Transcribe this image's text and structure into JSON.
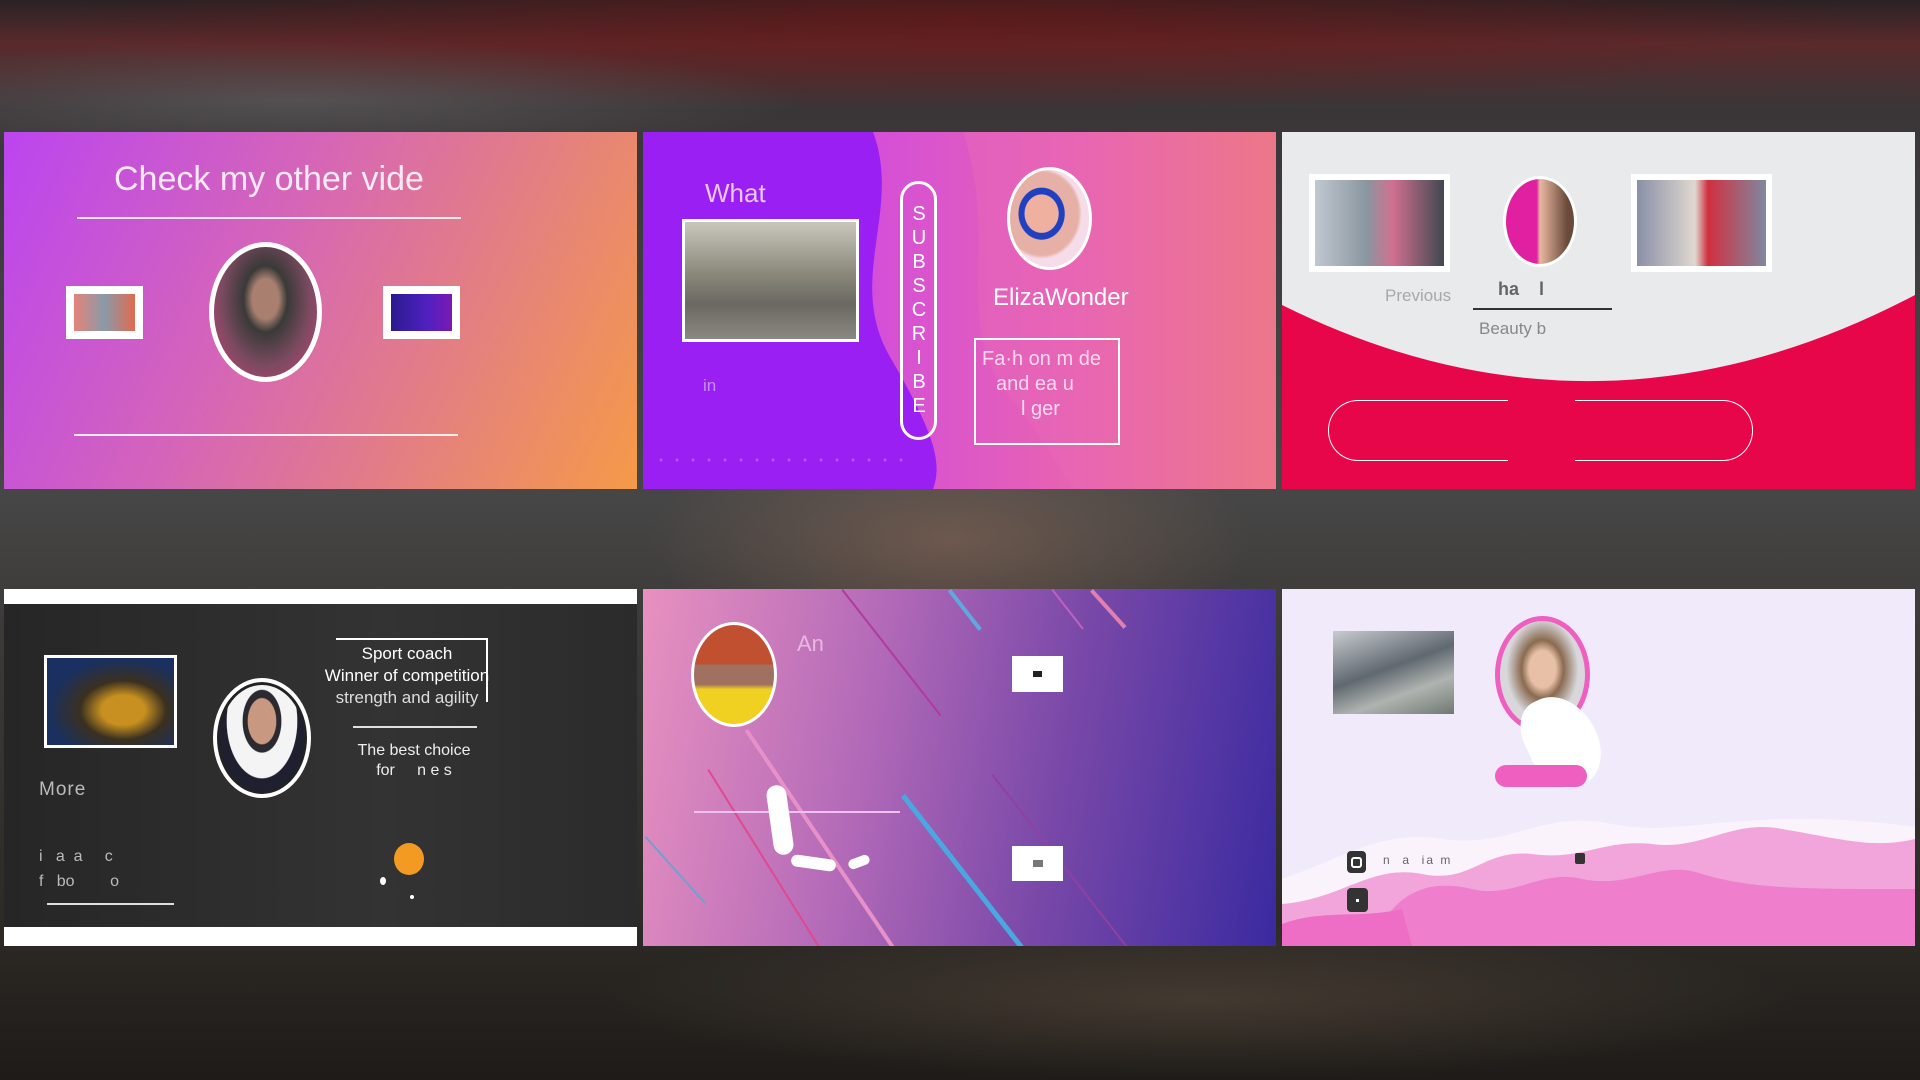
{
  "panel1": {
    "title": "Check my other vide"
  },
  "panel2": {
    "heading": "What",
    "bullet_text": "in",
    "subscribe": "SUBSCRIBE",
    "name": "ElizaWonder",
    "box_line1": "Fa·h on m de",
    "box_line2": "and  ea u",
    "box_line3": "l  ger"
  },
  "panel3": {
    "previous": "Previous",
    "channel_partial": "ha    l",
    "subtitle": "Beauty b",
    "accent": "#e8064a"
  },
  "panel4": {
    "more": "More",
    "info_line1": "Sport coach",
    "info_line2": "Winner of competition",
    "info_line3": "strength and agility",
    "tag_line1": "The best choice",
    "tag_line2": "for     n e s",
    "footer_line1": "i   a  a     c",
    "footer_line2": "f   bo        o",
    "accent": "#f39a22"
  },
  "panel5": {
    "heading": "An"
  },
  "panel6": {
    "social_text": "n  a  ia m",
    "social_icon1": "instagram-icon",
    "social_icon2": "social-icon",
    "accent": "#ee5fbf"
  }
}
